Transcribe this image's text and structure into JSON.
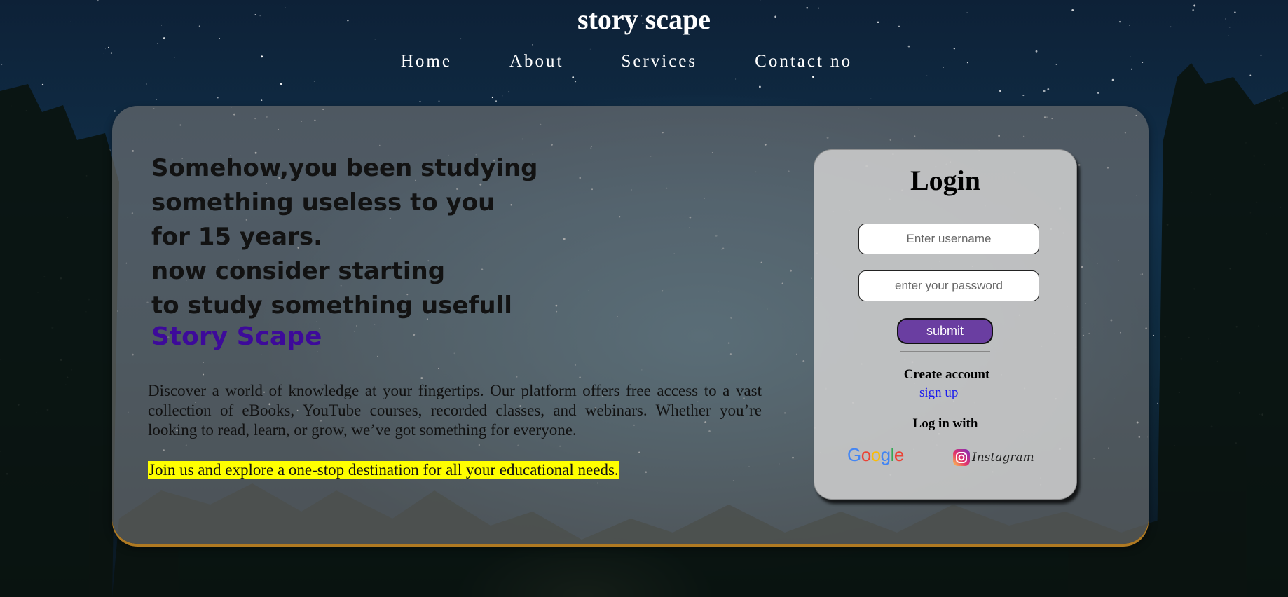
{
  "site": {
    "title": "story scape"
  },
  "nav": {
    "items": [
      "Home",
      "About",
      "Services",
      "Contact no"
    ]
  },
  "hero": {
    "headline_lines": [
      "Somehow,you been studying",
      "something useless to you",
      "for 15 years.",
      "now consider starting",
      "to study something usefull"
    ],
    "brand": "Story Scape",
    "description": "Discover a world of knowledge at your fingertips. Our platform offers free access to a vast collection of eBooks, YouTube courses, recorded classes, and webinars. Whether you’re looking to read, learn, or grow, we’ve got something for everyone.",
    "cta": "Join us and explore a one-stop destination for all your educational needs."
  },
  "login": {
    "title": "Login",
    "username_placeholder": "Enter username",
    "password_placeholder": "enter your password",
    "submit_label": "submit",
    "create_account": "Create account",
    "signup_link": "sign up",
    "login_with": "Log in with",
    "google_label": "Google",
    "instagram_label": "Instagram",
    "google_icon": "google-logo",
    "instagram_icon": "instagram-logo"
  },
  "colors": {
    "brand": "#3d0a9a",
    "submit": "#6a3ea1",
    "highlight": "#ffff00",
    "link": "#1a1aee"
  }
}
